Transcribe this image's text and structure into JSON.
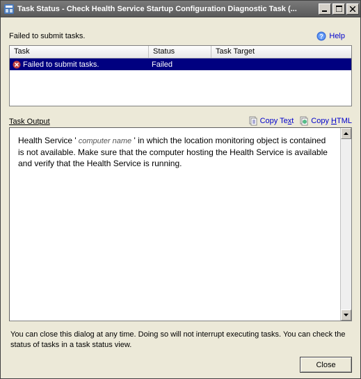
{
  "titlebar": {
    "title": "Task Status - Check Health Service Startup Configuration Diagnostic Task (..."
  },
  "status_summary": "Failed to submit tasks.",
  "help": {
    "label": "Help"
  },
  "table": {
    "headers": {
      "task": "Task",
      "status": "Status",
      "target": "Task Target"
    },
    "rows": [
      {
        "task": "Failed to submit tasks.",
        "status": "Failed",
        "target": ""
      }
    ]
  },
  "output": {
    "label": "Task Output",
    "copy_text_label": "Copy Text",
    "copy_html_label": "Copy HTML",
    "message_prefix": "Health Service '",
    "placeholder": "  computer name",
    "message_suffix": "   ' in which the location monitoring object is contained is not available. Make sure that the computer hosting the Health Service is available and verify that the Health Service is running."
  },
  "footer_note": "You can close this dialog at any time.  Doing so will not interrupt executing tasks.  You can check the status of tasks in a task status view.",
  "buttons": {
    "close": "Close"
  }
}
